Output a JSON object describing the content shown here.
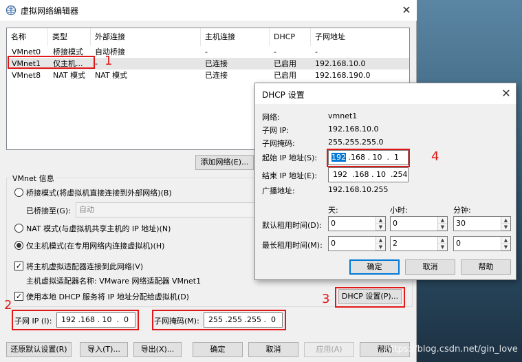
{
  "window": {
    "title": "虚拟网络编辑器",
    "close": "✕"
  },
  "list": {
    "headers": [
      "名称",
      "类型",
      "外部连接",
      "主机连接",
      "DHCP",
      "子网地址"
    ],
    "rows": [
      [
        "VMnet0",
        "桥接模式",
        "自动桥接",
        "-",
        "-",
        "-"
      ],
      [
        "VMnet1",
        "仅主机...",
        "-",
        "已连接",
        "已启用",
        "192.168.10.0"
      ],
      [
        "VMnet8",
        "NAT 模式",
        "NAT 模式",
        "已连接",
        "已启用",
        "192.168.190.0"
      ]
    ]
  },
  "buttons": {
    "add_network": "添加网络(E)..."
  },
  "vmnet_info": {
    "title": "VMnet 信息",
    "bridge_radio": "桥接模式(将虚拟机直接连接到外部网络)(B)",
    "bridged_to_label": "已桥接至(G):",
    "bridged_to_value": "自动",
    "nat_radio": "NAT 模式(与虚拟机共享主机的 IP 地址)(N)",
    "hostonly_radio": "仅主机模式(在专用网络内连接虚拟机)(H)",
    "connect_adapter_check": "将主机虚拟适配器连接到此网络(V)",
    "adapter_name_label": "主机虚拟适配器名称: VMware 网络适配器 VMnet1",
    "dhcp_check": "使用本地 DHCP 服务将 IP 地址分配给虚拟机(D)",
    "dhcp_settings_button": "DHCP 设置(P)...",
    "subnet_ip_label": "子网 IP (I):",
    "subnet_ip_value": "192 .168 . 10  .  0",
    "subnet_mask_label": "子网掩码(M):",
    "subnet_mask_value": "255 .255 .255 .  0"
  },
  "bottom_buttons": {
    "restore": "还原默认设置(R)",
    "import": "导入(T)...",
    "export": "导出(X)...",
    "ok": "确定",
    "cancel": "取消",
    "apply": "应用(A)",
    "help": "帮助"
  },
  "annotations": {
    "n1": "1",
    "n2": "2",
    "n3": "3",
    "n4": "4"
  },
  "dhcp": {
    "title": "DHCP 设置",
    "close": "✕",
    "network_label": "网络:",
    "network_value": "vmnet1",
    "subnet_ip_label": "子网 IP:",
    "subnet_ip_value": "192.168.10.0",
    "subnet_mask_label": "子网掩码:",
    "subnet_mask_value": "255.255.255.0",
    "start_ip_label": "起始 IP 地址(S):",
    "start_ip_first": "192",
    "start_ip_rest": " .168 . 10  .  1",
    "end_ip_label": "结束 IP 地址(E):",
    "end_ip_value": "192  .168 . 10  .254",
    "broadcast_label": "广播地址:",
    "broadcast_value": "192.168.10.255",
    "col_days": "天:",
    "col_hours": "小时:",
    "col_minutes": "分钟:",
    "default_lease_label": "默认租用时间(D):",
    "default_lease": [
      "0",
      "0",
      "30"
    ],
    "max_lease_label": "最长租用时间(M):",
    "max_lease": [
      "0",
      "2",
      "0"
    ],
    "ok": "确定",
    "cancel": "取消",
    "help": "帮助"
  },
  "watermark": "https://blog.csdn.net/gin_love"
}
